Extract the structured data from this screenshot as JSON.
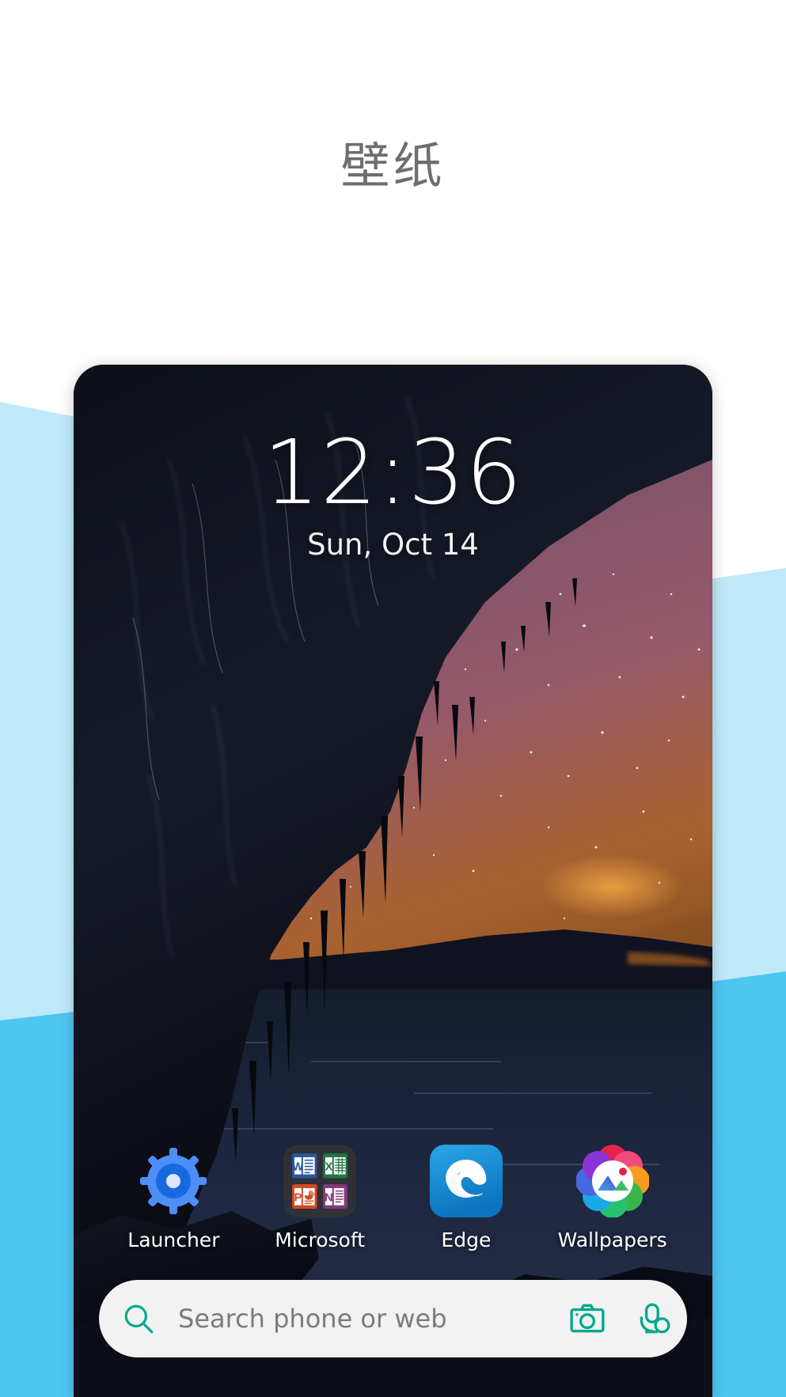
{
  "page": {
    "title": "壁纸",
    "title_color": "#6e6e6e",
    "background_color": "#ffffff",
    "accent_light_blue": "#bfe9f9",
    "accent_blue": "#4ec6f2"
  },
  "phone": {
    "lockscreen": {
      "time": "12:36",
      "date": "Sun, Oct 14"
    },
    "wallpaper": {
      "description": "Dark cave opening with stalactites framing a purple and orange starry sunset sky over a lake",
      "sky_top_color": "#6b4a66",
      "sky_mid_color": "#8d5a64",
      "sky_glow_color": "#b5651f",
      "water_color": "#1b2438",
      "cave_color": "#0a0c14"
    },
    "dock": {
      "apps": [
        {
          "label": "Launcher",
          "icon": "gear-icon",
          "color": "#4285f4"
        },
        {
          "label": "Microsoft",
          "icon": "microsoft-folder-icon",
          "tiles": [
            {
              "name": "word-icon",
              "letter": "W",
              "color": "#2b579a"
            },
            {
              "name": "excel-icon",
              "letter": "X",
              "color": "#217346"
            },
            {
              "name": "powerpoint-icon",
              "letter": "P",
              "color": "#d24726"
            },
            {
              "name": "onenote-icon",
              "letter": "N",
              "color": "#80397b"
            }
          ]
        },
        {
          "label": "Edge",
          "icon": "edge-icon",
          "color": "#0f8ed6"
        },
        {
          "label": "Wallpapers",
          "icon": "wallpapers-icon",
          "color": "#ffffff"
        }
      ]
    },
    "search": {
      "placeholder": "Search phone or web",
      "search_icon": "search-icon",
      "camera_icon": "camera-icon",
      "mic_icon": "microphone-icon",
      "icon_color": "#00a88e",
      "background": "#f2f2f2"
    }
  }
}
